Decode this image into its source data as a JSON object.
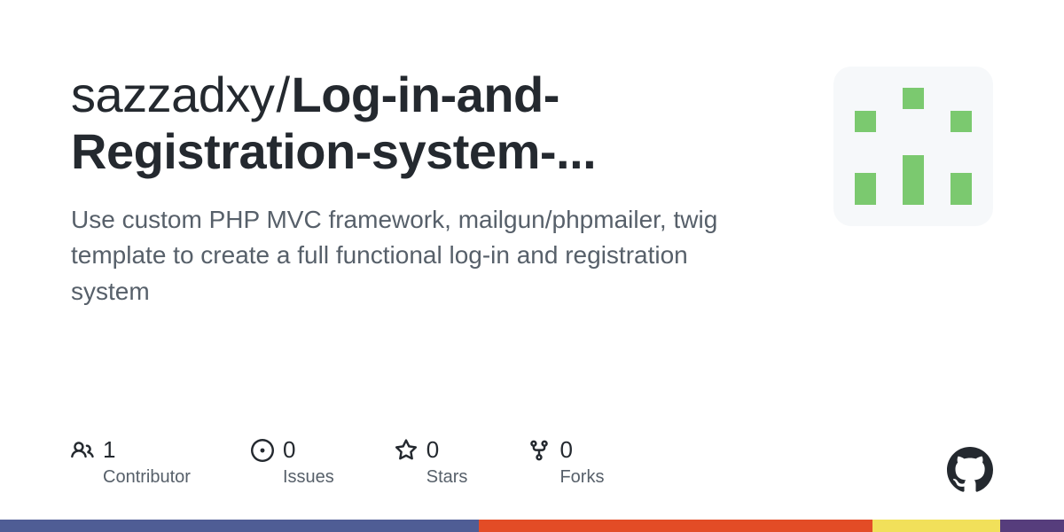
{
  "repo": {
    "owner": "sazzadxy",
    "name_display": "Log-in-and-Registration-system-...",
    "description": "Use custom PHP MVC framework, mailgun/phpmailer, twig template to create a full functional log-in and registration system"
  },
  "stats": {
    "contributors": {
      "value": "1",
      "label": "Contributor"
    },
    "issues": {
      "value": "0",
      "label": "Issues"
    },
    "stars": {
      "value": "0",
      "label": "Stars"
    },
    "forks": {
      "value": "0",
      "label": "Forks"
    }
  },
  "colors": {
    "identicon": "#7bc96f",
    "bar_segments": [
      {
        "color": "#4F5D95",
        "width": "45%"
      },
      {
        "color": "#e34c26",
        "width": "37%"
      },
      {
        "color": "#f1e05a",
        "width": "12%"
      },
      {
        "color": "#563d7c",
        "width": "6%"
      }
    ]
  }
}
